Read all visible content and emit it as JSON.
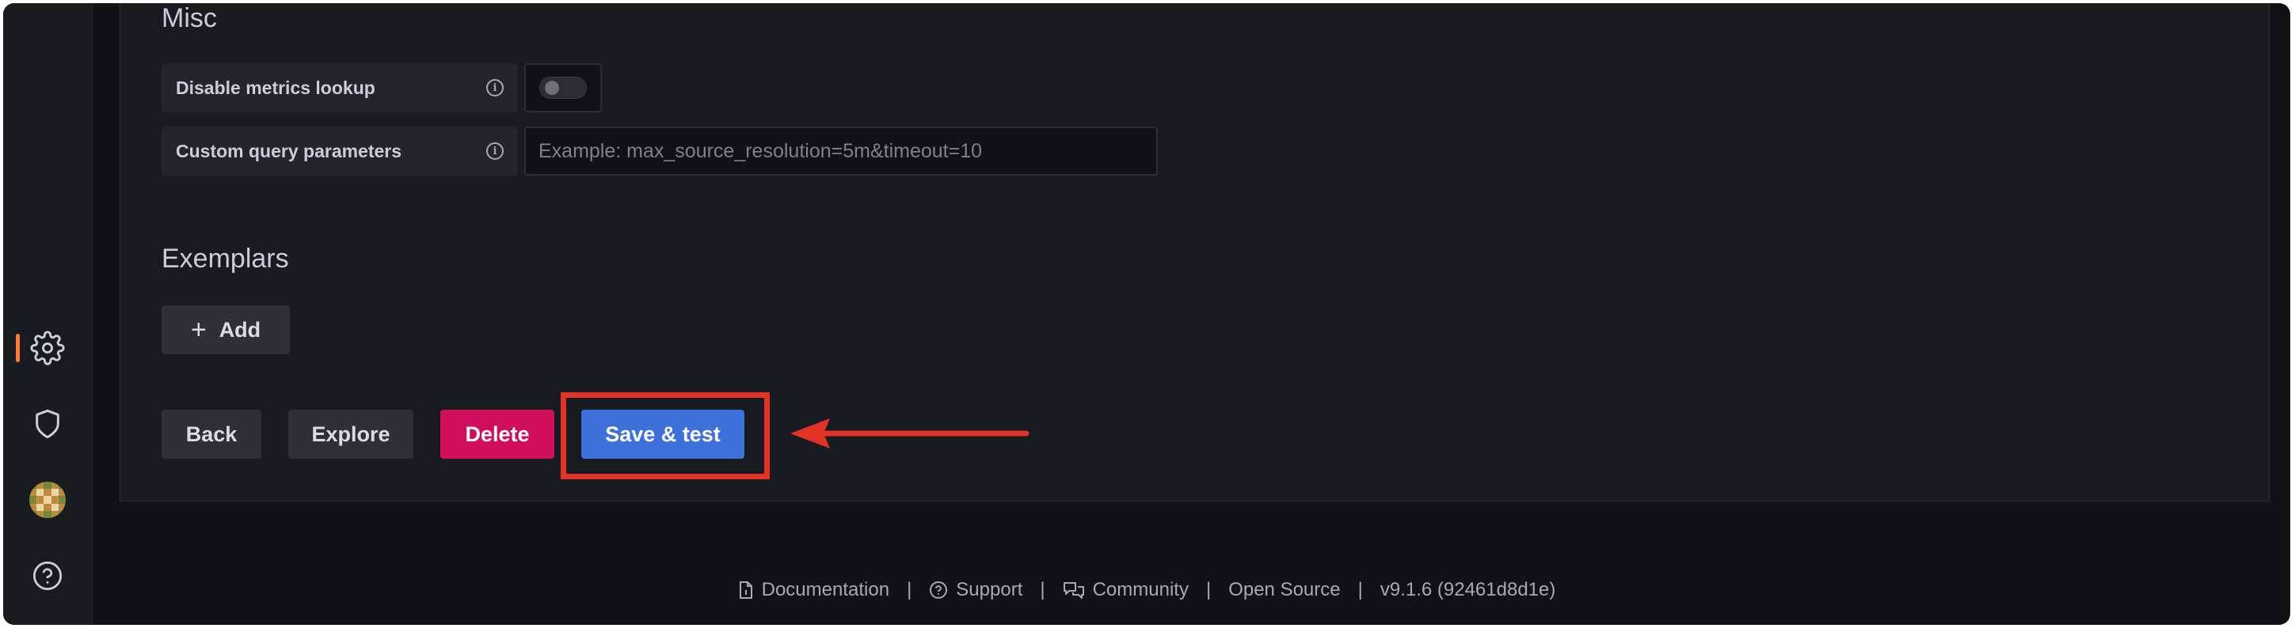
{
  "misc": {
    "title": "Misc",
    "disable_metrics_lookup": {
      "label": "Disable metrics lookup",
      "enabled": false
    },
    "custom_query_parameters": {
      "label": "Custom query parameters",
      "value": "",
      "placeholder": "Example: max_source_resolution=5m&timeout=10"
    }
  },
  "exemplars": {
    "title": "Exemplars",
    "add_label": "Add"
  },
  "actions": {
    "back": "Back",
    "explore": "Explore",
    "delete": "Delete",
    "save_test": "Save & test"
  },
  "footer": {
    "documentation": "Documentation",
    "support": "Support",
    "community": "Community",
    "open_source": "Open Source",
    "version": "v9.1.6 (92461d8d1e)",
    "separator": "|"
  },
  "sidebar": {
    "items": [
      {
        "name": "configuration",
        "icon": "gear-icon",
        "active": true
      },
      {
        "name": "server-admin",
        "icon": "shield-icon",
        "active": false
      },
      {
        "name": "profile",
        "icon": "avatar",
        "active": false
      },
      {
        "name": "help",
        "icon": "help-icon",
        "active": false
      }
    ]
  },
  "colors": {
    "accent_active": "#ff7a30",
    "primary": "#3d71d9",
    "destructive": "#d10e5c",
    "annotation": "#e53227"
  }
}
